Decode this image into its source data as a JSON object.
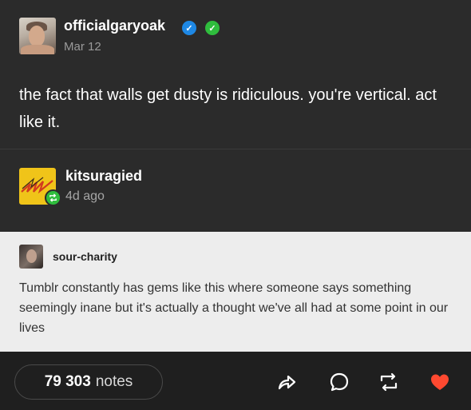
{
  "original_post": {
    "author": "officialgaryoak",
    "date": "Mar 12",
    "text": "the fact that walls get dusty is ridiculous. you're vertical. act like it.",
    "badges": [
      "verified-blue-icon",
      "verified-green-icon"
    ]
  },
  "reblog": {
    "author": "kitsuragied",
    "time": "4d ago"
  },
  "comment": {
    "author": "sour-charity",
    "text": "Tumblr constantly has gems like this where someone says something seemingly inane but it's actually a thought we've all had at some point in our lives"
  },
  "footer": {
    "notes_count": "79 303",
    "notes_label": "notes",
    "icons": [
      "share-icon",
      "reply-icon",
      "reblog-icon",
      "like-icon"
    ]
  },
  "colors": {
    "verified_blue": "#1e88e5",
    "verified_green": "#2fbd3d",
    "like_red": "#ff4930",
    "dark_bg": "#2b2b2b",
    "light_bg": "#ededed"
  }
}
